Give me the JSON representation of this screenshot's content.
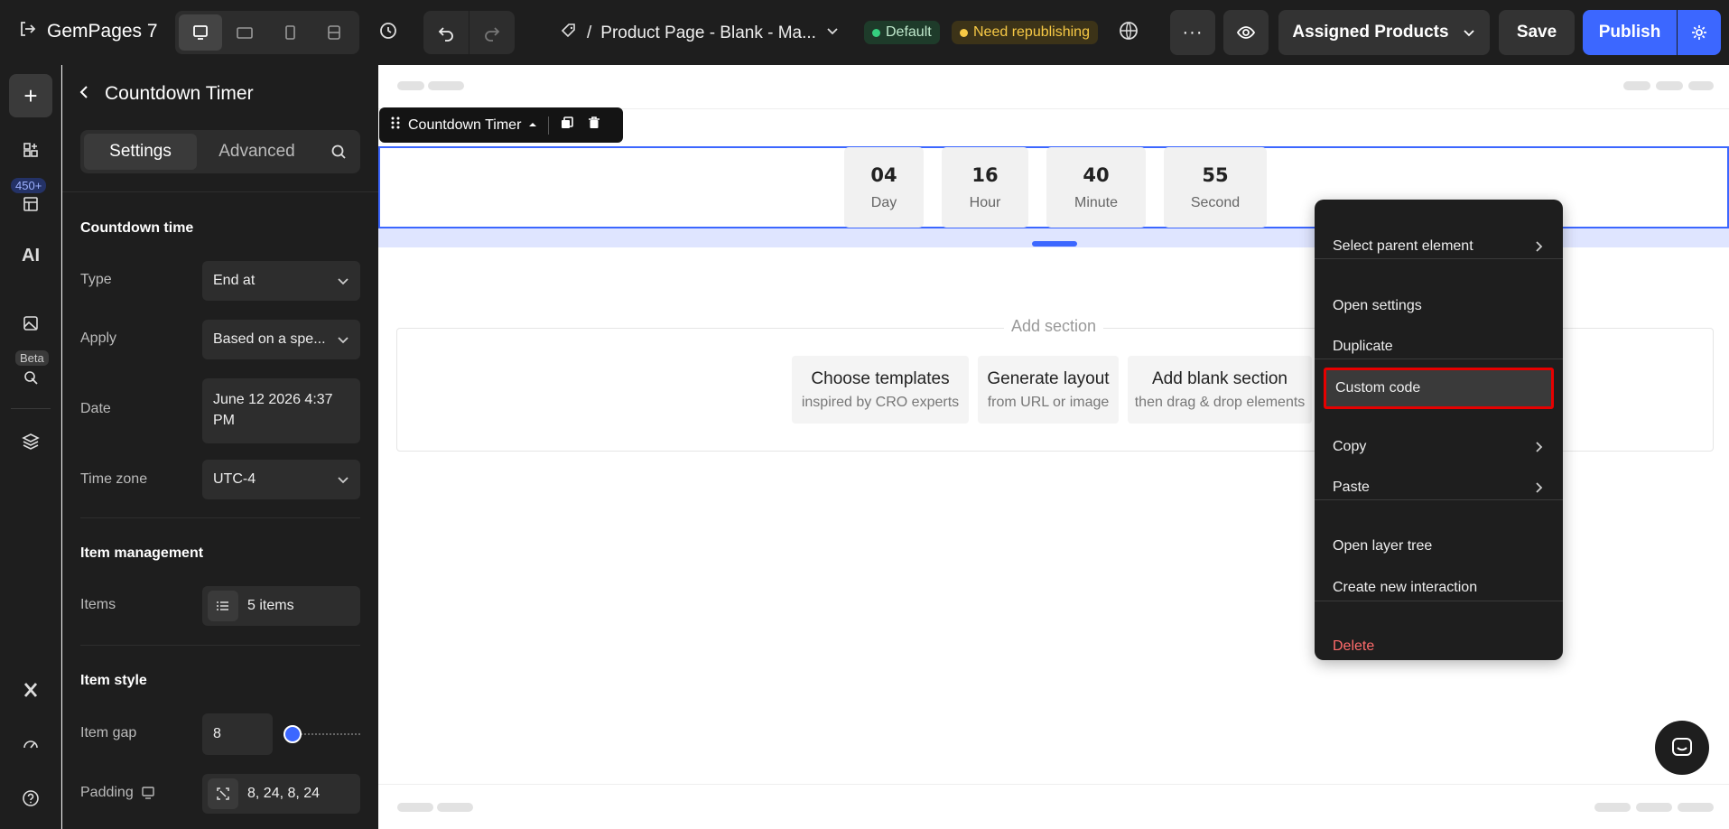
{
  "topbar": {
    "brand": "GemPages 7",
    "page_prefix": "/",
    "page_title": "Product Page - Blank - Ma...",
    "badge_default": "Default",
    "badge_warning": "Need republishing",
    "more_label": "···",
    "assigned_label": "Assigned Products",
    "save_label": "Save",
    "publish_label": "Publish"
  },
  "rail": {
    "count_badge": "450+",
    "ai_label": "AI",
    "beta_label": "Beta"
  },
  "panel": {
    "title": "Countdown Timer",
    "tabs": {
      "settings": "Settings",
      "advanced": "Advanced"
    },
    "countdown_section": "Countdown time",
    "type_label": "Type",
    "type_value": "End at",
    "apply_label": "Apply",
    "apply_value": "Based on a spe...",
    "date_label": "Date",
    "date_value": "June 12 2026 4:37 PM",
    "timezone_label": "Time zone",
    "timezone_value": "UTC-4",
    "item_mgmt_section": "Item management",
    "items_label": "Items",
    "items_value": "5 items",
    "item_style_section": "Item style",
    "item_gap_label": "Item gap",
    "item_gap_value": "8",
    "padding_label": "Padding",
    "padding_value": "8, 24, 8, 24"
  },
  "canvas": {
    "selected_element": "Countdown Timer",
    "countdown": [
      {
        "value": "04",
        "label": "Day"
      },
      {
        "value": "16",
        "label": "Hour"
      },
      {
        "value": "40",
        "label": "Minute"
      },
      {
        "value": "55",
        "label": "Second"
      }
    ],
    "add_section_title": "Add section",
    "cards": [
      {
        "title": "Choose templates",
        "subtitle": "inspired by CRO experts"
      },
      {
        "title": "Generate layout",
        "subtitle": "from URL or image"
      },
      {
        "title": "Add blank section",
        "subtitle": "then drag & drop elements"
      }
    ]
  },
  "context_menu": {
    "select_parent": "Select parent element",
    "open_settings": "Open settings",
    "duplicate": "Duplicate",
    "custom_code": "Custom code",
    "copy": "Copy",
    "paste": "Paste",
    "open_layer_tree": "Open layer tree",
    "create_interaction": "Create new interaction",
    "delete": "Delete"
  },
  "colors": {
    "accent": "#3c67ff",
    "highlight_border": "#e60000",
    "danger": "#ff6b6b",
    "success": "#35d07f",
    "warning": "#f7c945"
  },
  "slider": {
    "item_gap_fraction": 0.12
  }
}
